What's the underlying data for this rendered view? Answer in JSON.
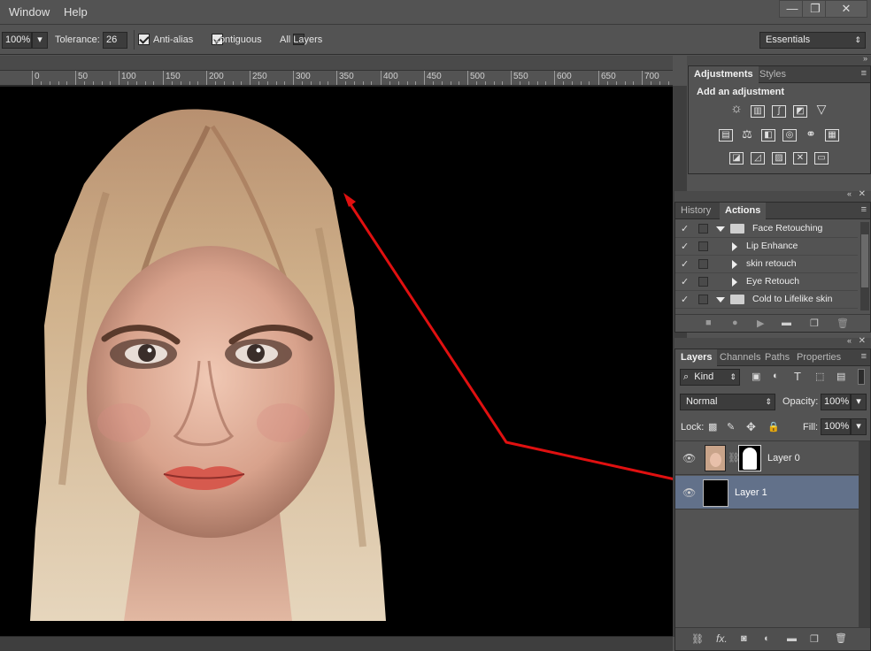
{
  "menu": {
    "window": "Window",
    "help": "Help"
  },
  "window_controls": {
    "minimize": "—",
    "restore": "❐",
    "close": "✕"
  },
  "options": {
    "sample_size": "100%",
    "tolerance_label": "Tolerance:",
    "tolerance_value": "26",
    "anti_alias_label": "Anti-alias",
    "contiguous_label": "Contiguous",
    "all_layers_label": "All Layers",
    "workspace": "Essentials"
  },
  "ruler": {
    "labels": [
      "0",
      "50",
      "100",
      "150",
      "200",
      "250",
      "300",
      "350",
      "400",
      "450",
      "500",
      "550",
      "600",
      "650",
      "700"
    ]
  },
  "adjustments_panel": {
    "tabs": [
      "Adjustments",
      "Styles"
    ],
    "heading": "Add an adjustment"
  },
  "history_panel": {
    "tabs": [
      "History",
      "Actions"
    ],
    "actions": [
      {
        "label": "Face Retouching",
        "type": "set"
      },
      {
        "label": "Lip Enhance",
        "type": "action"
      },
      {
        "label": "skin retouch",
        "type": "action"
      },
      {
        "label": "Eye Retouch",
        "type": "action"
      },
      {
        "label": "Cold to Lifelike skin",
        "type": "set"
      }
    ]
  },
  "layers_panel": {
    "tabs": [
      "Layers",
      "Channels",
      "Paths",
      "Properties"
    ],
    "filter_kind": "Kind",
    "blend_mode": "Normal",
    "opacity_label": "Opacity:",
    "opacity_value": "100%",
    "lock_label": "Lock:",
    "fill_label": "Fill:",
    "fill_value": "100%",
    "layers": [
      {
        "name": "Layer 0",
        "selected": false
      },
      {
        "name": "Layer 1",
        "selected": true
      }
    ],
    "footer_fx": "fx."
  },
  "colors": {
    "selected_layer": "#62718a",
    "annotation_arrow": "#e01010"
  }
}
